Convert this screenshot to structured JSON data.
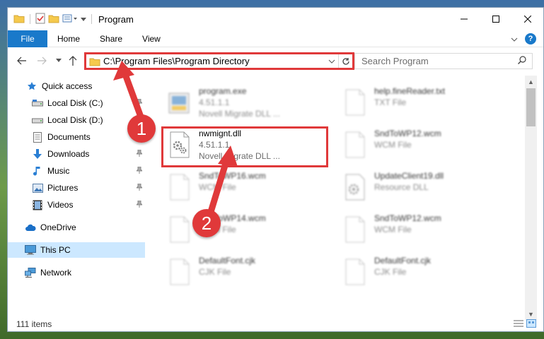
{
  "window": {
    "title": "Program"
  },
  "ribbon": {
    "tabs": [
      "File",
      "Home",
      "Share",
      "View"
    ]
  },
  "address": {
    "path": "C:\\Program Files\\Program Directory"
  },
  "search": {
    "placeholder": "Search Program"
  },
  "nav": {
    "items": [
      {
        "label": "Quick access",
        "icon": "star-icon"
      },
      {
        "label": "Local Disk (C:)",
        "icon": "drive-icon"
      },
      {
        "label": "Local Disk (D:)",
        "icon": "drive-icon"
      },
      {
        "label": "Documents",
        "icon": "documents-icon"
      },
      {
        "label": "Downloads",
        "icon": "downloads-icon"
      },
      {
        "label": "Music",
        "icon": "music-icon"
      },
      {
        "label": "Pictures",
        "icon": "pictures-icon"
      },
      {
        "label": "Videos",
        "icon": "videos-icon"
      },
      {
        "label": "OneDrive",
        "icon": "cloud-icon"
      },
      {
        "label": "This PC",
        "icon": "computer-icon"
      },
      {
        "label": "Network",
        "icon": "network-icon"
      }
    ]
  },
  "files": [
    {
      "name": "program.exe",
      "line2": "4.51.1.1",
      "line3": "Novell Migrate DLL ..."
    },
    {
      "name": "help.fineReader.txt",
      "line2": "TXT File",
      "line3": ""
    },
    {
      "name": "nwmignt.dll",
      "line2": "4.51.1.1",
      "line3": "Novell Migrate DLL ..."
    },
    {
      "name": "SndToWP12.wcm",
      "line2": "WCM File",
      "line3": ""
    },
    {
      "name": "SndToWP16.wcm",
      "line2": "WCM File",
      "line3": ""
    },
    {
      "name": "UpdateClient19.dll",
      "line2": "Resource DLL",
      "line3": ""
    },
    {
      "name": "SndToWP14.wcm",
      "line2": "WCM File",
      "line3": ""
    },
    {
      "name": "SndToWP12.wcm",
      "line2": "WCM File",
      "line3": ""
    },
    {
      "name": "DefaultFont.cjk",
      "line2": "CJK File",
      "line3": ""
    },
    {
      "name": "DefaultFont.cjk",
      "line2": "CJK File",
      "line3": ""
    }
  ],
  "status": {
    "item_count": "111 items"
  },
  "callouts": [
    "1",
    "2"
  ],
  "colors": {
    "accent": "#1979ca",
    "highlight": "#e0393a",
    "selected": "#cce8ff"
  }
}
